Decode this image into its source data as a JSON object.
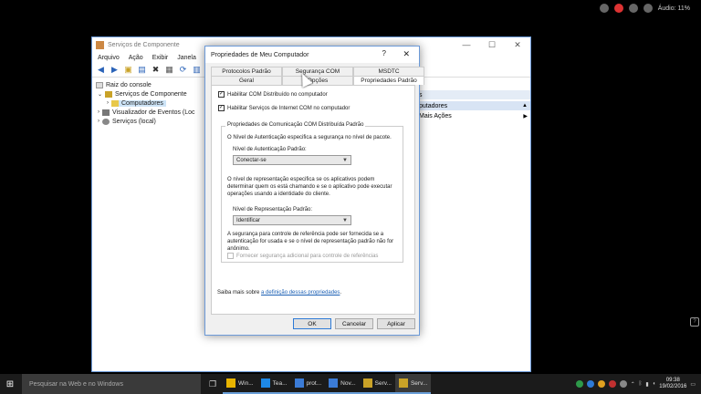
{
  "recorder": {
    "status_text": "Áudio: 11%"
  },
  "mmc": {
    "title": "Serviços de Componente",
    "menu": [
      "Arquivo",
      "Ação",
      "Exibir",
      "Janela"
    ],
    "tree": [
      {
        "label": "Raiz do console",
        "level": 0
      },
      {
        "label": "Serviços de Componente",
        "level": 1
      },
      {
        "label": "Computadores",
        "level": 2
      },
      {
        "label": "Visualizador de Eventos (Loc",
        "level": 1
      },
      {
        "label": "Serviços (local)",
        "level": 1
      }
    ],
    "actions": {
      "header": "s",
      "section": "putadores",
      "more": "Mais Ações"
    }
  },
  "dialog": {
    "title": "Propriedades de Meu Computador",
    "help_glyph": "?",
    "close_glyph": "✕",
    "tabs_back": [
      "Protocolos Padrão",
      "Segurança COM",
      "MSDTC"
    ],
    "tabs_front": [
      "Geral",
      "Opções",
      "Propriedades Padrão"
    ],
    "active_tab": "Propriedades Padrão",
    "enable_dcom": "Habilitar COM Distribuído no computador",
    "enable_internet": "Habilitar Serviços de Internet COM no computador",
    "group_title": "Propriedades de Comunicação COM Distribuída Padrão",
    "auth_desc": "O Nível de Autenticação especifica a segurança no nível de pacote.",
    "auth_label": "Nível de Autenticação Padrão:",
    "auth_value": "Conectar-se",
    "imp_desc": "O nível de representação especifica se os aplicativos podem determinar quem os está chamando e se o aplicativo pode executar operações usando a identidade do cliente.",
    "imp_label": "Nível de Representação Padrão:",
    "imp_value": "Identificar",
    "ref_desc": "A segurança para controle de referência pode ser fornecida se a autenticação for usada e se o nível de representação padrão não for anônimo.",
    "ref_check": "Fornecer segurança adicional para controle de referências",
    "learn_prefix": "Saiba mais sobre ",
    "learn_link": "a definição dessas propriedades",
    "learn_suffix": ".",
    "ok": "OK",
    "cancel": "Cancelar",
    "apply": "Aplicar"
  },
  "taskbar": {
    "search_placeholder": "Pesquisar na Web e no Windows",
    "apps": [
      {
        "label": "Win...",
        "color": "#e8b400"
      },
      {
        "label": "Tea...",
        "color": "#1e88e5"
      },
      {
        "label": "prot...",
        "color": "#3b7bd6"
      },
      {
        "label": "Nov...",
        "color": "#3b7bd6"
      },
      {
        "label": "Serv...",
        "color": "#c9a227"
      },
      {
        "label": "Serv...",
        "color": "#c9a227"
      }
    ],
    "time": "09:38",
    "date": "19/02/2016"
  }
}
